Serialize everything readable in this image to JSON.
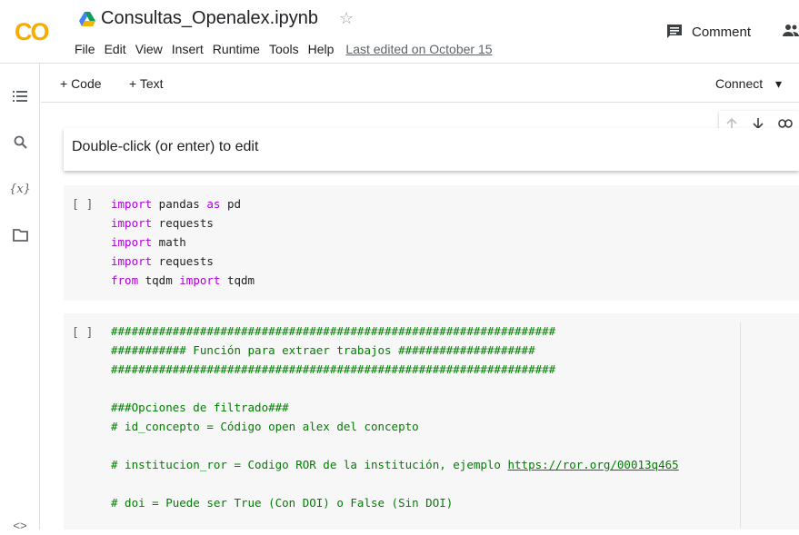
{
  "header": {
    "logo_text": "CO",
    "notebook_title": "Consultas_Openalex.ipynb",
    "star_glyph": "☆",
    "menu": [
      "File",
      "Edit",
      "View",
      "Insert",
      "Runtime",
      "Tools",
      "Help"
    ],
    "last_edited": "Last edited on October 15",
    "comment_label": "Comment",
    "icons": [
      "drive-icon",
      "star-icon",
      "comment-icon",
      "share-icon"
    ]
  },
  "sidebar": {
    "icons": [
      "toc-icon",
      "search-icon",
      "variables-icon",
      "folder-icon",
      "code-snippets-icon"
    ],
    "variables_label": "{x}",
    "snippets_label": "<>"
  },
  "toolbar": {
    "add_code": "+ Code",
    "add_text": "+ Text",
    "connect": "Connect",
    "connect_arrow": "▾"
  },
  "text_cell": {
    "placeholder": "Double-click (or enter) to edit"
  },
  "cell1": {
    "run": "[ ]",
    "lines": [
      [
        {
          "t": "import",
          "c": "kw"
        },
        {
          "t": " pandas "
        },
        {
          "t": "as",
          "c": "kw"
        },
        {
          "t": " pd"
        }
      ],
      [
        {
          "t": "import",
          "c": "kw"
        },
        {
          "t": " requests"
        }
      ],
      [
        {
          "t": "import",
          "c": "kw"
        },
        {
          "t": " math"
        }
      ],
      [
        {
          "t": "import",
          "c": "kw"
        },
        {
          "t": " requests"
        }
      ],
      [
        {
          "t": "from",
          "c": "kw"
        },
        {
          "t": " tqdm "
        },
        {
          "t": "import",
          "c": "kw"
        },
        {
          "t": " tqdm"
        }
      ]
    ]
  },
  "cell2": {
    "run": "[ ]",
    "lines": [
      [
        {
          "t": "#################################################################",
          "c": "cm"
        }
      ],
      [
        {
          "t": "########### Función para extraer trabajos ####################",
          "c": "cm"
        }
      ],
      [
        {
          "t": "#################################################################",
          "c": "cm"
        }
      ],
      [
        {
          "t": ""
        }
      ],
      [
        {
          "t": "###Opciones de filtrado###",
          "c": "cm"
        }
      ],
      [
        {
          "t": "# id_concepto = Código open alex del concepto",
          "c": "cm"
        }
      ],
      [
        {
          "t": ""
        }
      ],
      [
        {
          "t": "# institucion_ror = Codigo ROR de la institución, ejemplo ",
          "c": "cm"
        },
        {
          "t": "https://ror.org/00013q465",
          "c": "link"
        }
      ],
      [
        {
          "t": ""
        }
      ],
      [
        {
          "t": "# doi = Puede ser True (Con DOI) o False (Sin DOI)",
          "c": "cm"
        }
      ]
    ]
  }
}
